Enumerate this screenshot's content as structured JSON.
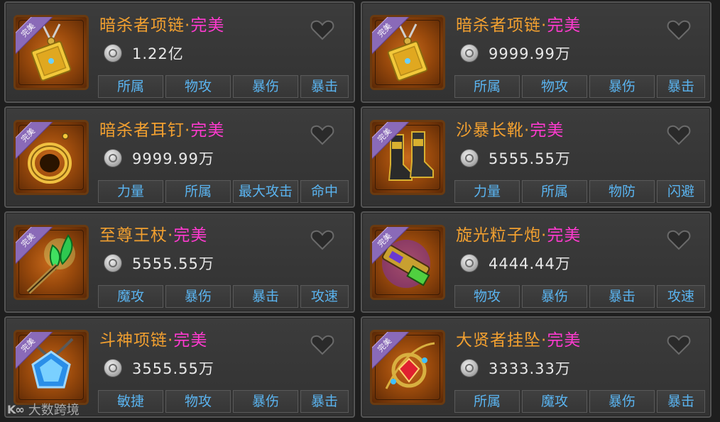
{
  "quality_badge": "完美",
  "items": [
    {
      "name": "暗杀者项链",
      "quality": "完美",
      "price": "1.22亿",
      "tags": [
        "所属",
        "物攻",
        "暴伤",
        "暴击"
      ],
      "art": "gold-pendant-icon"
    },
    {
      "name": "暗杀者项链",
      "quality": "完美",
      "price": "9999.99万",
      "tags": [
        "所属",
        "物攻",
        "暴伤",
        "暴击"
      ],
      "art": "gold-pendant-icon"
    },
    {
      "name": "暗杀者耳钉",
      "quality": "完美",
      "price": "9999.99万",
      "tags": [
        "力量",
        "所属",
        "最大攻击",
        "命中"
      ],
      "art": "gold-earring-icon"
    },
    {
      "name": "沙暴长靴",
      "quality": "完美",
      "price": "5555.55万",
      "tags": [
        "力量",
        "所属",
        "物防",
        "闪避"
      ],
      "art": "boots-icon"
    },
    {
      "name": "至尊王杖",
      "quality": "完美",
      "price": "5555.55万",
      "tags": [
        "魔攻",
        "暴伤",
        "暴击",
        "攻速"
      ],
      "art": "green-staff-icon"
    },
    {
      "name": "旋光粒子炮",
      "quality": "完美",
      "price": "4444.44万",
      "tags": [
        "物攻",
        "暴伤",
        "暴击",
        "攻速"
      ],
      "art": "particle-cannon-icon"
    },
    {
      "name": "斗神项链",
      "quality": "完美",
      "price": "3555.55万",
      "tags": [
        "敏捷",
        "物攻",
        "暴伤",
        "暴击"
      ],
      "art": "blue-gem-necklace-icon"
    },
    {
      "name": "大贤者挂坠",
      "quality": "完美",
      "price": "3333.33万",
      "tags": [
        "所属",
        "魔攻",
        "暴伤",
        "暴击"
      ],
      "art": "ruby-pendant-icon"
    }
  ],
  "colors": {
    "name": "#f2a030",
    "quality": "#ff3ad0",
    "tag_text": "#5ab4f0",
    "price_text": "#e8e8e8"
  },
  "watermark": "大数跨境",
  "watermark_logo": "K∞"
}
